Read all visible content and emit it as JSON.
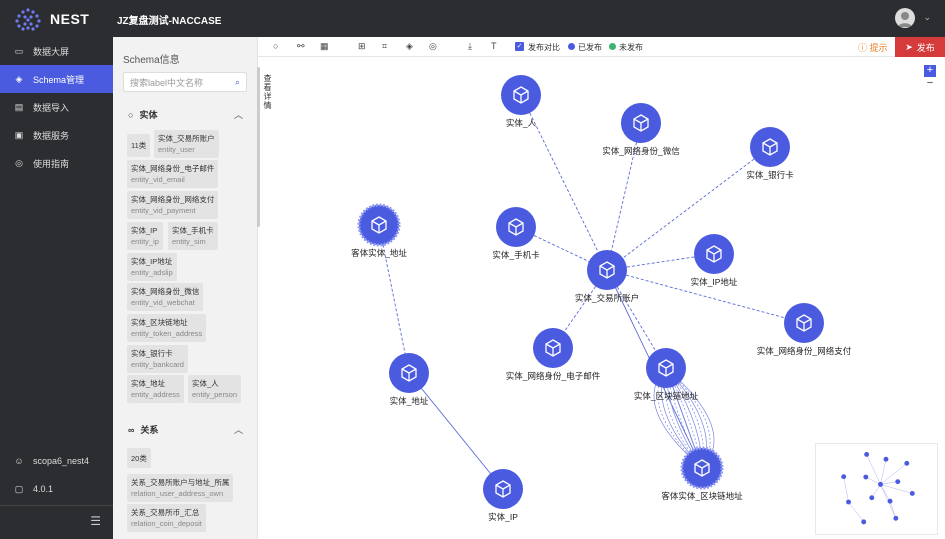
{
  "header": {
    "brand": "NEST",
    "project": "JZ复盘测试-NACCASE"
  },
  "nav": {
    "items": [
      {
        "label": "数据大屏",
        "icon": "monitor-icon"
      },
      {
        "label": "Schema管理",
        "icon": "schema-icon"
      },
      {
        "label": "数据导入",
        "icon": "import-icon"
      },
      {
        "label": "数据服务",
        "icon": "service-icon"
      },
      {
        "label": "使用指南",
        "icon": "guide-icon"
      }
    ],
    "user": "scopa6_nest4",
    "version": "4.0.1"
  },
  "schema_panel": {
    "title": "Schema信息",
    "search_placeholder": "搜索label中文名称",
    "entities_title": "实体",
    "entities_count": "11类",
    "entities": [
      {
        "name": "实体_交易所账户",
        "code": "entity_user"
      },
      {
        "name": "实体_网络身份_电子邮件",
        "code": "entity_vid_email"
      },
      {
        "name": "实体_网络身份_网络支付",
        "code": "entity_vid_payment"
      },
      {
        "name": "实体_IP",
        "code": "entity_ip"
      },
      {
        "name": "实体_手机卡",
        "code": "entity_sim"
      },
      {
        "name": "实体_IP地址",
        "code": "entity_adslip"
      },
      {
        "name": "实体_网络身份_微信",
        "code": "entity_vid_webchat"
      },
      {
        "name": "实体_区块链地址",
        "code": "entity_token_address"
      },
      {
        "name": "实体_银行卡",
        "code": "entity_bankcard"
      },
      {
        "name": "实体_地址",
        "code": "entity_address"
      },
      {
        "name": "实体_人",
        "code": "entity_person"
      }
    ],
    "relations_title": "关系",
    "relations_count": "20类",
    "relations": [
      {
        "name": "关系_交易所账户与地址_所属",
        "code": "relation_user_address_own"
      },
      {
        "name": "关系_交易所币_汇总",
        "code": "relation_coin_deposit"
      }
    ]
  },
  "toolbar": {
    "compare_label": "发布对比",
    "published_label": "已发布",
    "unpublished_label": "未发布",
    "hint_label": "提示",
    "publish_label": "发布",
    "published_color": "#4a5be0",
    "unpublished_color": "#3cb371"
  },
  "side_tab": "查看详情",
  "graph": {
    "node_color": "#4a5be0",
    "nodes": [
      {
        "id": "person",
        "label": "实体_人"
      },
      {
        "id": "wechat",
        "label": "实体_网络身份_微信"
      },
      {
        "id": "bank",
        "label": "实体_银行卡"
      },
      {
        "id": "customer_addr",
        "label": "客体实体_地址"
      },
      {
        "id": "sim",
        "label": "实体_手机卡"
      },
      {
        "id": "ipaddr",
        "label": "实体_IP地址"
      },
      {
        "id": "account",
        "label": "实体_交易所账户"
      },
      {
        "id": "payment",
        "label": "实体_网络身份_网络支付"
      },
      {
        "id": "email",
        "label": "实体_网络身份_电子邮件"
      },
      {
        "id": "chain",
        "label": "实体_区块链地址"
      },
      {
        "id": "address",
        "label": "实体_地址"
      },
      {
        "id": "customer_chain",
        "label": "客体实体_区块链地址"
      },
      {
        "id": "ip",
        "label": "实体_IP"
      }
    ]
  }
}
